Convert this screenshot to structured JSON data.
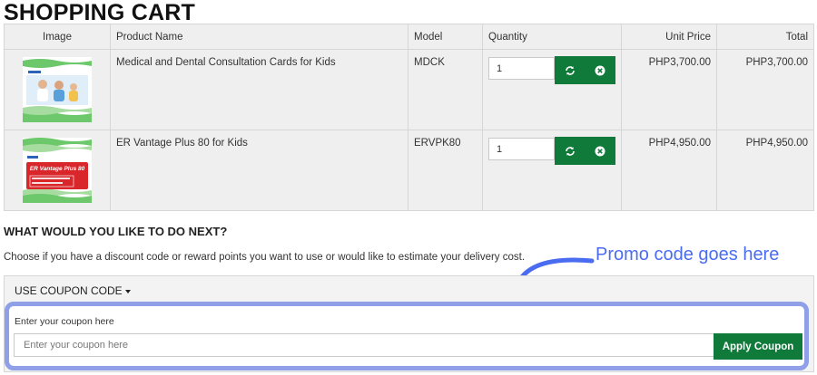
{
  "page": {
    "title": "SHOPPING CART"
  },
  "cart": {
    "headers": {
      "image": "Image",
      "product_name": "Product Name",
      "model": "Model",
      "quantity": "Quantity",
      "unit_price": "Unit Price",
      "total": "Total"
    },
    "rows": [
      {
        "name": "Medical and Dental Consultation Cards for Kids",
        "model": "MDCK",
        "quantity": "1",
        "unit_price": "PHP3,700.00",
        "total": "PHP3,700.00",
        "thumb_icon": "product-thumbnail-family-photo"
      },
      {
        "name": "ER Vantage Plus 80 for Kids",
        "model": "ERVPK80",
        "quantity": "1",
        "unit_price": "PHP4,950.00",
        "total": "PHP4,950.00",
        "thumb_icon": "product-thumbnail-red-card",
        "card_text": "ER Vantage Plus 80"
      }
    ],
    "row_actions": {
      "update_icon": "refresh-icon",
      "remove_icon": "remove-circle-icon"
    }
  },
  "next_steps": {
    "title": "WHAT WOULD YOU LIKE TO DO NEXT?",
    "description": "Choose if you have a discount code or reward points you want to use or would like to estimate your delivery cost."
  },
  "annotation": {
    "text": "Promo code goes here"
  },
  "coupon": {
    "toggle_label": "USE COUPON CODE",
    "field_label": "Enter your coupon here",
    "placeholder": "Enter your coupon here",
    "value": "",
    "apply_label": "Apply Coupon"
  },
  "colors": {
    "button_green": "#0f7a3a",
    "annotation_blue": "#4a6cf0",
    "highlight_border": "#8fa0e8",
    "table_bg": "#efefef"
  }
}
